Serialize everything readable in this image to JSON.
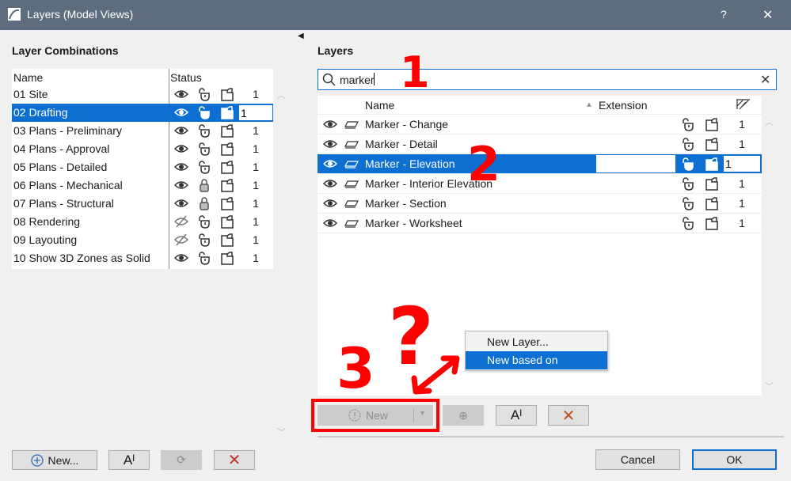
{
  "window": {
    "title": "Layers (Model Views)",
    "help": "?",
    "close": "✕"
  },
  "left": {
    "heading": "Layer Combinations",
    "col_name": "Name",
    "col_status": "Status",
    "items": [
      {
        "name": "01 Site",
        "visible": true,
        "locked": false,
        "num": "1"
      },
      {
        "name": "02 Drafting",
        "visible": true,
        "locked": false,
        "num": "1",
        "selected": true
      },
      {
        "name": "03 Plans - Preliminary",
        "visible": true,
        "locked": false,
        "num": "1"
      },
      {
        "name": "04 Plans - Approval",
        "visible": true,
        "locked": false,
        "num": "1"
      },
      {
        "name": "05 Plans - Detailed",
        "visible": true,
        "locked": false,
        "num": "1"
      },
      {
        "name": "06 Plans - Mechanical",
        "visible": true,
        "locked": true,
        "num": "1"
      },
      {
        "name": "07 Plans - Structural",
        "visible": true,
        "locked": true,
        "num": "1"
      },
      {
        "name": "08 Rendering",
        "visible": false,
        "locked": false,
        "num": "1"
      },
      {
        "name": "09 Layouting",
        "visible": false,
        "locked": false,
        "num": "1"
      },
      {
        "name": "10 Show 3D Zones as Solid",
        "visible": true,
        "locked": false,
        "num": "1"
      }
    ],
    "buttons": {
      "new": "New..."
    }
  },
  "right": {
    "heading": "Layers",
    "search_value": "marker",
    "col_name": "Name",
    "col_extension": "Extension",
    "items": [
      {
        "name": "Marker - Change",
        "num": "1"
      },
      {
        "name": "Marker - Detail",
        "num": "1"
      },
      {
        "name": "Marker - Elevation",
        "num": "1",
        "selected": true
      },
      {
        "name": "Marker - Interior Elevation",
        "num": "1"
      },
      {
        "name": "Marker - Section",
        "num": "1"
      },
      {
        "name": "Marker - Worksheet",
        "num": "1"
      }
    ],
    "new_button": "New",
    "menu": [
      "New Layer...",
      "New based on Selected..."
    ]
  },
  "footer": {
    "cancel": "Cancel",
    "ok": "OK"
  },
  "annotations": [
    "1",
    "2",
    "3",
    "?"
  ],
  "colors": {
    "accent": "#0c6fd1",
    "annotation": "#ff0000",
    "titlebar": "#5d6d7e"
  }
}
